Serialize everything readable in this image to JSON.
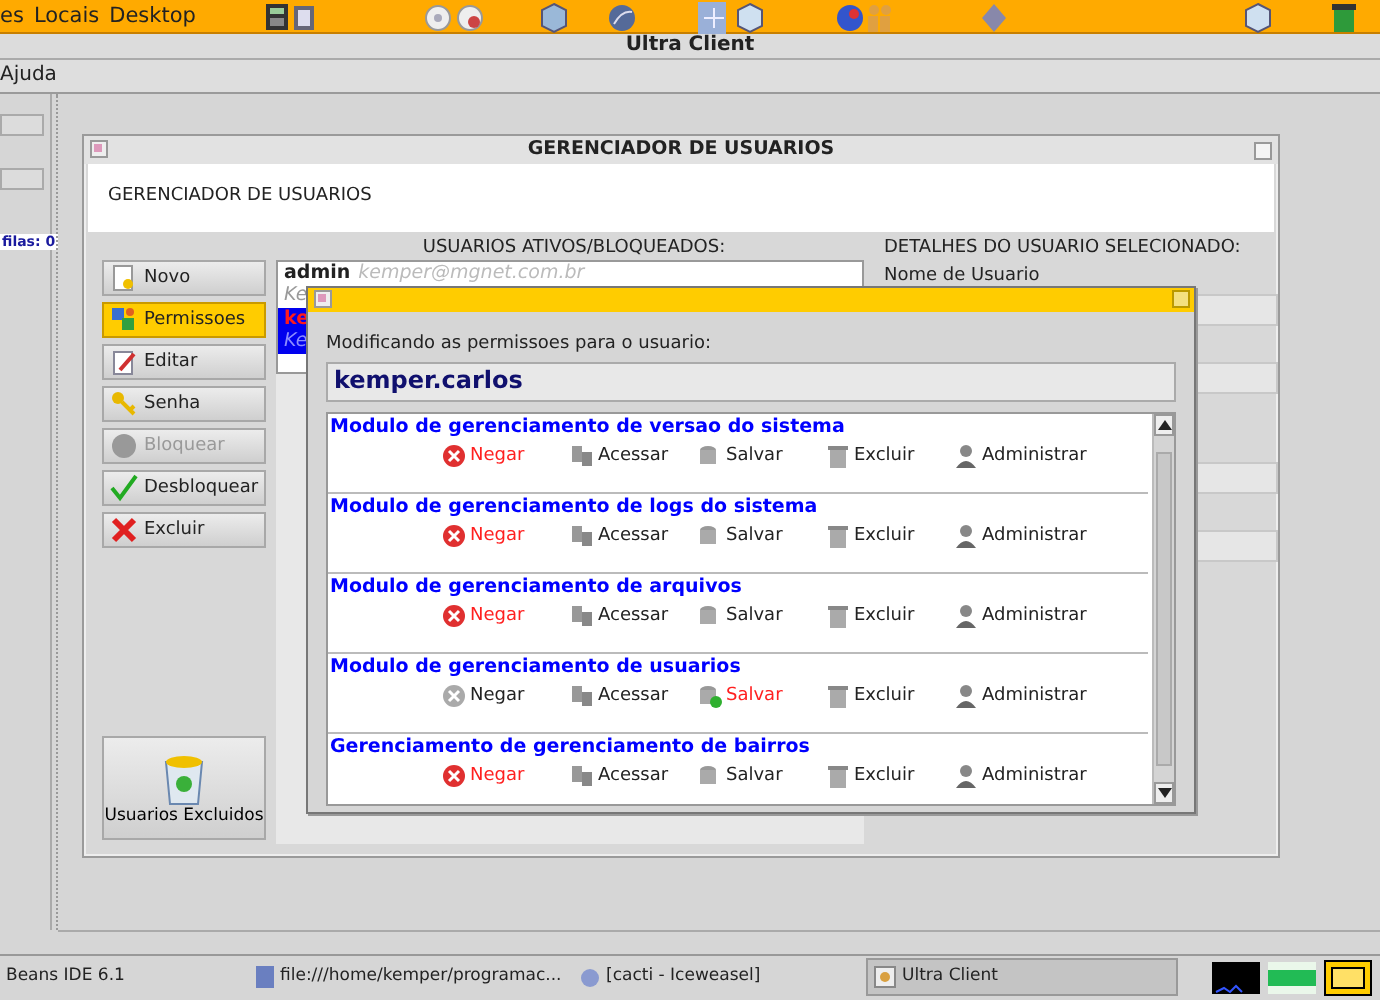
{
  "top_panel": {
    "menus": [
      "es",
      "Locais",
      "Desktop"
    ]
  },
  "window": {
    "title": "Ultra Client"
  },
  "menu_bar": [
    "Ajuda"
  ],
  "left_panel": {
    "queue_label": "filas: 0"
  },
  "internal_frame": {
    "title": "GERENCIADOR DE USUARIOS",
    "header": "GERENCIADOR DE USUARIOS",
    "users_heading": "USUARIOS ATIVOS/BLOQUEADOS:",
    "details_heading": "DETALHES DO USUARIO SELECIONADO:",
    "details_label": "Nome de Usuario",
    "actions": [
      {
        "label": "Novo",
        "kind": "new",
        "selected": false,
        "disabled": false
      },
      {
        "label": "Permissoes",
        "kind": "permissions",
        "selected": true,
        "disabled": false
      },
      {
        "label": "Editar",
        "kind": "edit",
        "selected": false,
        "disabled": false
      },
      {
        "label": "Senha",
        "kind": "password",
        "selected": false,
        "disabled": false
      },
      {
        "label": "Bloquear",
        "kind": "block",
        "selected": false,
        "disabled": true
      },
      {
        "label": "Desbloquear",
        "kind": "unblock",
        "selected": false,
        "disabled": false
      },
      {
        "label": "Excluir",
        "kind": "delete",
        "selected": false,
        "disabled": false
      }
    ],
    "trash_button": "Usuarios Excluidos",
    "users": [
      {
        "login": "admin",
        "email": "kemper@mgnet.com.br",
        "name": "Ke",
        "selected": false
      },
      {
        "login": "ke",
        "name": "Ke",
        "selected": true
      }
    ]
  },
  "dialog": {
    "prompt": "Modificando as permissoes para o usuario:",
    "username": "kemper.carlos",
    "modules": [
      {
        "title": "Modulo de gerenciamento de versao do sistema",
        "permissions": [
          {
            "label": "Negar",
            "kind": "deny",
            "active": true
          },
          {
            "label": "Acessar",
            "kind": "access",
            "active": false
          },
          {
            "label": "Salvar",
            "kind": "save",
            "active": false
          },
          {
            "label": "Excluir",
            "kind": "delete",
            "active": false
          },
          {
            "label": "Administrar",
            "kind": "admin",
            "active": false
          }
        ]
      },
      {
        "title": "Modulo de gerenciamento de logs do sistema",
        "permissions": [
          {
            "label": "Negar",
            "kind": "deny",
            "active": true
          },
          {
            "label": "Acessar",
            "kind": "access",
            "active": false
          },
          {
            "label": "Salvar",
            "kind": "save",
            "active": false
          },
          {
            "label": "Excluir",
            "kind": "delete",
            "active": false
          },
          {
            "label": "Administrar",
            "kind": "admin",
            "active": false
          }
        ]
      },
      {
        "title": "Modulo de gerenciamento de arquivos",
        "permissions": [
          {
            "label": "Negar",
            "kind": "deny",
            "active": true
          },
          {
            "label": "Acessar",
            "kind": "access",
            "active": false
          },
          {
            "label": "Salvar",
            "kind": "save",
            "active": false
          },
          {
            "label": "Excluir",
            "kind": "delete",
            "active": false
          },
          {
            "label": "Administrar",
            "kind": "admin",
            "active": false
          }
        ]
      },
      {
        "title": "Modulo de gerenciamento de usuarios",
        "permissions": [
          {
            "label": "Negar",
            "kind": "deny",
            "active": false
          },
          {
            "label": "Acessar",
            "kind": "access",
            "active": false
          },
          {
            "label": "Salvar",
            "kind": "save",
            "active": true
          },
          {
            "label": "Excluir",
            "kind": "delete",
            "active": false
          },
          {
            "label": "Administrar",
            "kind": "admin",
            "active": false
          }
        ]
      },
      {
        "title": "Gerenciamento de gerenciamento de bairros",
        "permissions": [
          {
            "label": "Negar",
            "kind": "deny",
            "active": true
          },
          {
            "label": "Acessar",
            "kind": "access",
            "active": false
          },
          {
            "label": "Salvar",
            "kind": "save",
            "active": false
          },
          {
            "label": "Excluir",
            "kind": "delete",
            "active": false
          },
          {
            "label": "Administrar",
            "kind": "admin",
            "active": false
          }
        ]
      }
    ]
  },
  "taskbar": {
    "items": [
      {
        "label": "Beans IDE 6.1",
        "kind": "plain",
        "active": false
      },
      {
        "label": "file:///home/kemper/programac...",
        "kind": "file",
        "active": false
      },
      {
        "label": "[cacti - Iceweasel]",
        "kind": "browser",
        "active": false
      },
      {
        "label": "Ultra Client",
        "kind": "app",
        "active": true
      }
    ]
  }
}
